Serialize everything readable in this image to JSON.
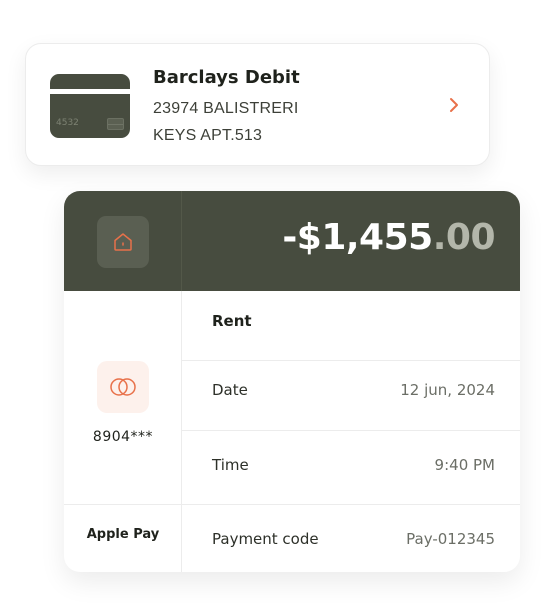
{
  "card": {
    "name": "Barclays Debit",
    "address_line1": "23974 BALISTRERI",
    "address_line2": "KEYS APT.513",
    "thumb_digits": "4532",
    "icon": "chevron-right-icon"
  },
  "transaction": {
    "amount_main": "-$1,455",
    "amount_cents": ".00",
    "category_icon": "home-icon",
    "card_icon": "mastercard-icon",
    "account_number": "8904***",
    "payment_method": "Apple Pay",
    "title": "Rent",
    "date_label": "Date",
    "date_value": "12 jun, 2024",
    "time_label": "Time",
    "time_value": "9:40 PM",
    "code_label": "Payment code",
    "code_value": "Pay-012345"
  },
  "colors": {
    "header_bg": "#474c3f",
    "accent": "#e8714a",
    "text_dark": "#1f221c",
    "text_muted": "#6b6e66"
  }
}
